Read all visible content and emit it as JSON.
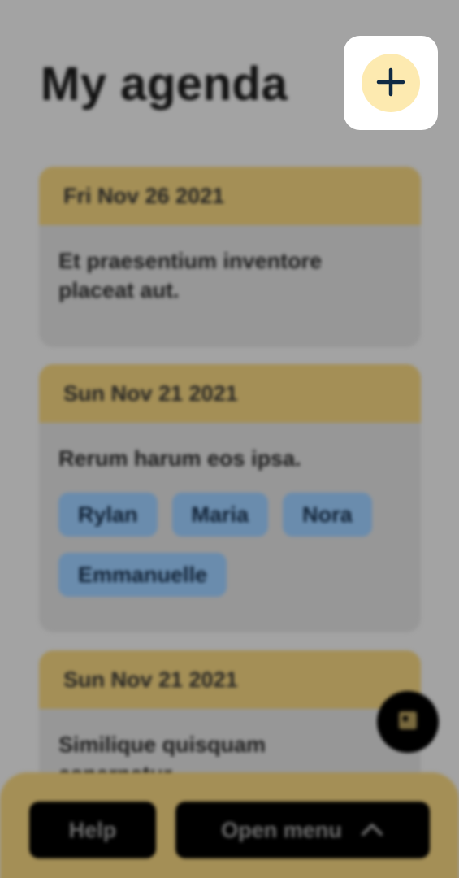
{
  "header": {
    "title": "My agenda",
    "add_icon": "plus-icon"
  },
  "agenda": [
    {
      "date": "Fri Nov 26 2021",
      "text": "Et praesentium inventore placeat aut.",
      "people": []
    },
    {
      "date": "Sun Nov 21 2021",
      "text": "Rerum harum eos ipsa.",
      "people": [
        "Rylan",
        "Maria",
        "Nora",
        "Emmanuelle"
      ]
    },
    {
      "date": "Sun Nov 21 2021",
      "text": "Similique quisquam aspernatur",
      "people": []
    }
  ],
  "floating_action": {
    "icon": "calendar-icon"
  },
  "footer": {
    "help_label": "Help",
    "menu_label": "Open menu",
    "menu_icon": "chevron-up-icon"
  },
  "colors": {
    "overlay_background": "#a3a3a3",
    "card_header": "#a48f56",
    "tag": "#6a8cad",
    "add_button": "#fdeab0",
    "add_button_icon": "#0f2a44"
  }
}
